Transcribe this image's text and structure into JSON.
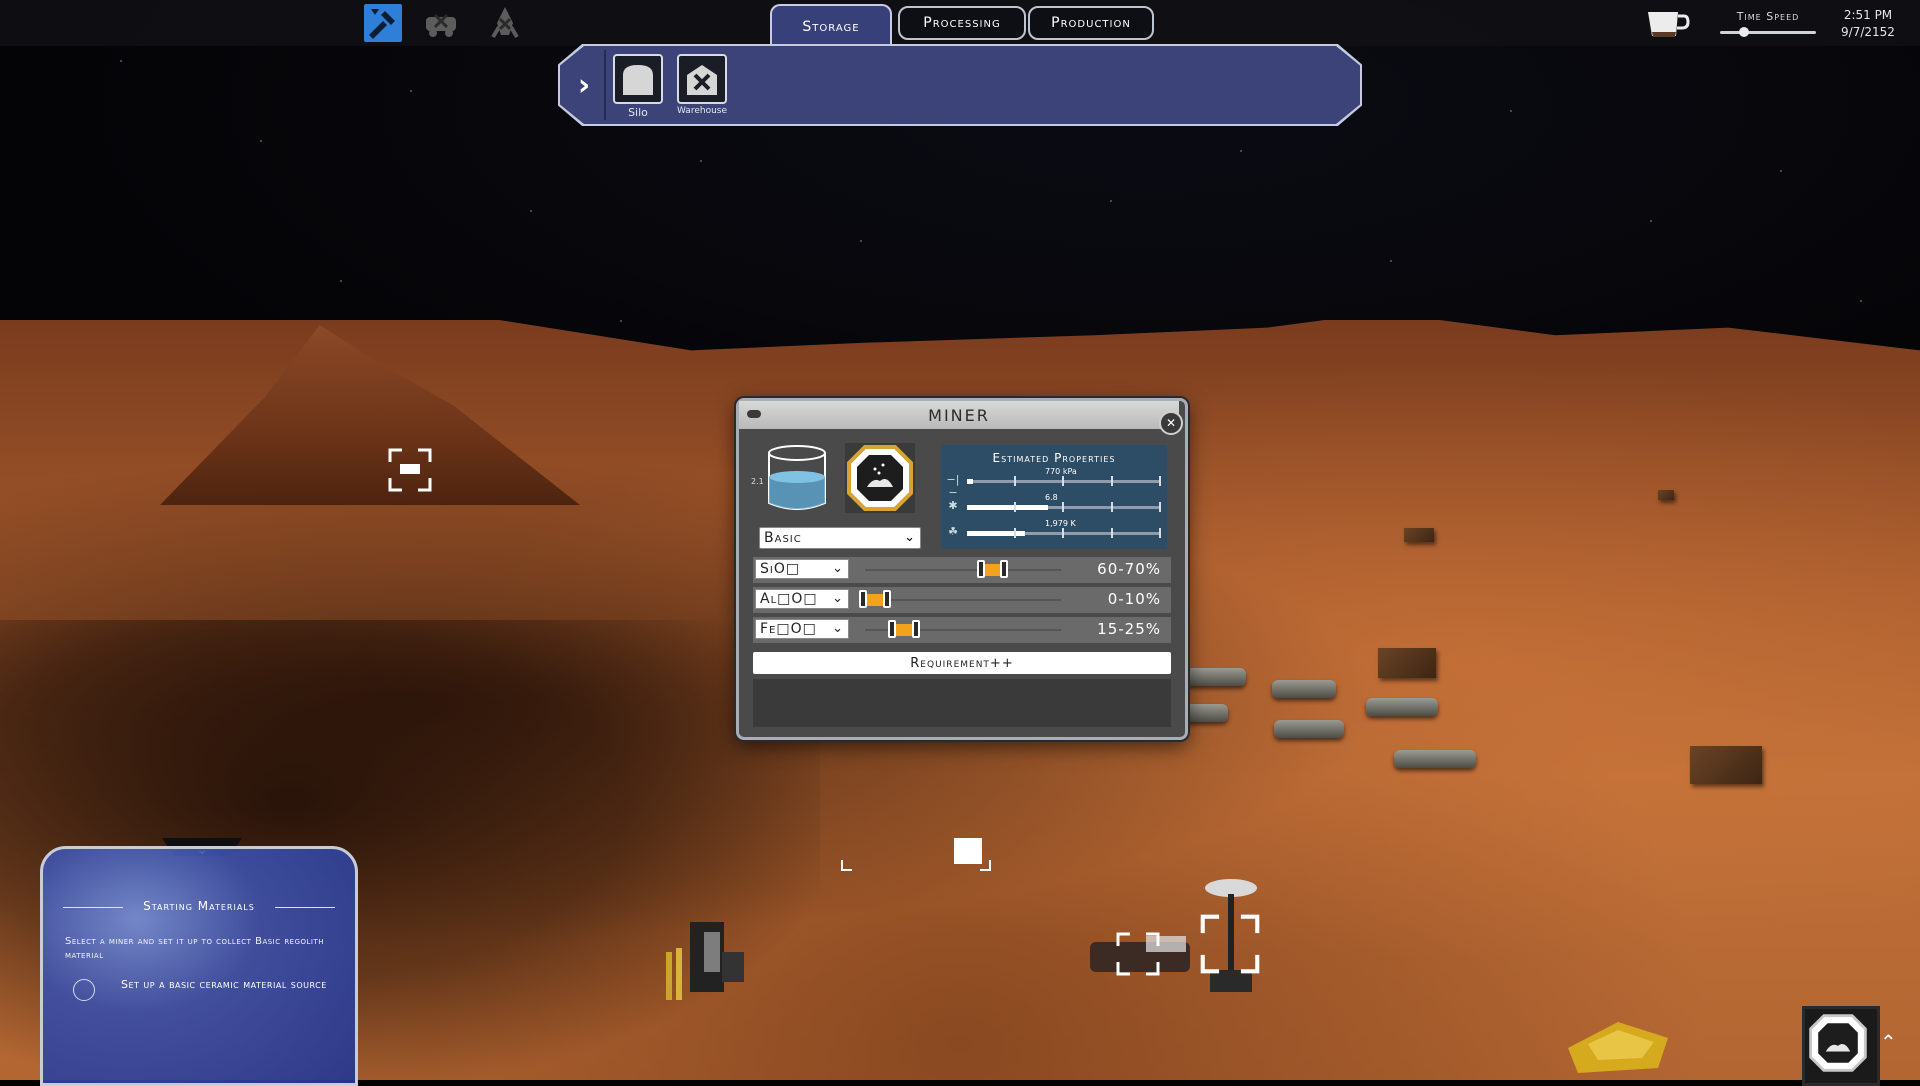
{
  "topbar": {
    "category_icons": [
      {
        "name": "tools-icon",
        "active": true
      },
      {
        "name": "vehicle-tools-icon",
        "active": false
      },
      {
        "name": "rocket-tools-icon",
        "active": false
      }
    ],
    "tabs": [
      {
        "label": "Storage",
        "active": true
      },
      {
        "label": "Processing",
        "active": false
      },
      {
        "label": "Production",
        "active": false
      }
    ],
    "time_speed_label": "Time Speed",
    "time_speed_level": 0.25,
    "time": "2:51 PM",
    "date": "9/7/2152"
  },
  "build_menu": {
    "items": [
      {
        "label": "Silo",
        "icon": "silo-icon"
      },
      {
        "label": "Warehouse",
        "icon": "warehouse-icon"
      }
    ]
  },
  "miner_dialog": {
    "title": "MINER",
    "tank_level_label": "2.1",
    "material_select": "Basic",
    "properties_title": "Estimated Properties",
    "properties": [
      {
        "icon": "pressure-icon",
        "value": "770 kPa",
        "fill": 0.03
      },
      {
        "icon": "density-icon",
        "value": "6.8",
        "fill": 0.42
      },
      {
        "icon": "temperature-icon",
        "value": "1,979 K",
        "fill": 0.3
      }
    ],
    "composition": [
      {
        "element": "SiO□",
        "range_text": "60-70%",
        "min": 60,
        "max": 70
      },
      {
        "element": "Al□O□",
        "range_text": "0-10%",
        "min": 0,
        "max": 10
      },
      {
        "element": "Fe□O□",
        "range_text": "15-25%",
        "min": 15,
        "max": 25
      }
    ],
    "requirement_button": "Requirement++"
  },
  "objective": {
    "title": "Starting Materials",
    "description": "Select a miner and set it up to collect Basic regolith material",
    "task": "Set up a basic ceramic material source"
  },
  "colors": {
    "accent_orange": "#f2a21b",
    "panel_blue": "#3b4379",
    "props_blue": "#2d4d67",
    "active_icon_blue": "#2f7ed8"
  }
}
